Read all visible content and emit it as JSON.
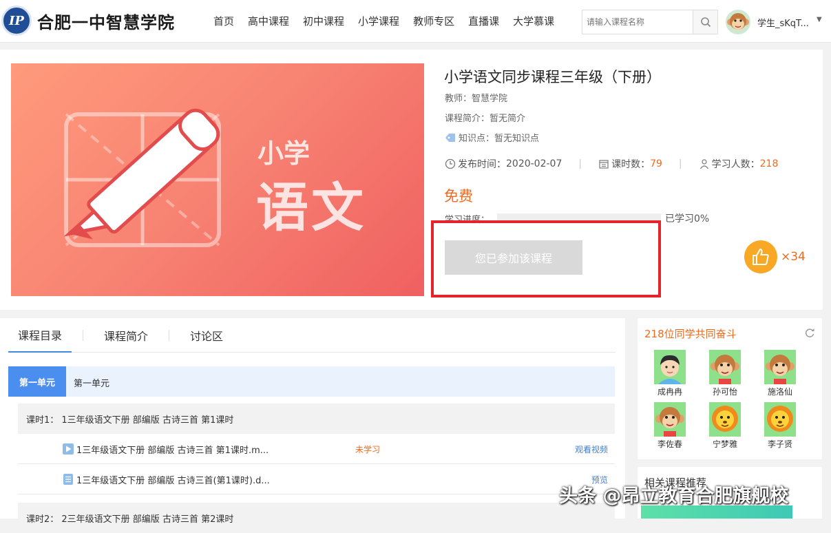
{
  "header": {
    "logo_mark": "IP",
    "site_title": "合肥一中智慧学院",
    "nav": [
      "首页",
      "高中课程",
      "初中课程",
      "小学课程",
      "教师专区",
      "直播课",
      "大学慕课"
    ],
    "search_placeholder": "请输入课程名称",
    "username": "学生_sKqT..."
  },
  "cover": {
    "line1": "小学",
    "line2": "语文"
  },
  "course": {
    "title": "小学语文同步课程三年级（下册）",
    "teacher": "教师：智慧学院",
    "intro": "课程简介：暂无简介",
    "knowledge": "知识点：暂无知识点",
    "publish_label": "发布时间：",
    "publish_date": "2020-02-07",
    "lessons_label": "课时数：",
    "lessons_count": "79",
    "learners_label": "学习人数：",
    "learners_count": "218",
    "price": "免费",
    "progress_label": "学习进度：",
    "progress_value": 0,
    "progress_text": "已学习0%",
    "joined_button": "您已参加该课程",
    "likes": "×34"
  },
  "tabs": [
    "课程目录",
    "课程简介",
    "讨论区"
  ],
  "catalog": {
    "unit_badge": "第一单元",
    "unit_name": "第一单元",
    "lesson1": "课时1：  1三年级语文下册 部编版 古诗三首 第1课时",
    "item1": {
      "name": "1三年级语文下册 部编版 古诗三首 第1课时.m...",
      "status": "未学习",
      "action": "观看视频"
    },
    "item2": {
      "name": "1三年级语文下册 部编版 古诗三首(第1课时).d...",
      "action": "预览"
    },
    "lesson2": "课时2：  2三年级语文下册 部编版 古诗三首 第2课时"
  },
  "classmates": {
    "title": "218位同学共同奋斗",
    "students": [
      "成冉冉",
      "孙可怡",
      "施洛仙",
      "李佐春",
      "宁梦雅",
      "李子贤"
    ]
  },
  "related": {
    "title": "相关课程推荐"
  },
  "watermark": "头条 @昂立教育合肥旗舰校",
  "colors": {
    "accent_orange": "#f06a1e",
    "primary_blue": "#4a8ef0",
    "highlight_red": "#e5232a",
    "cover_gradient": "#f78272"
  }
}
